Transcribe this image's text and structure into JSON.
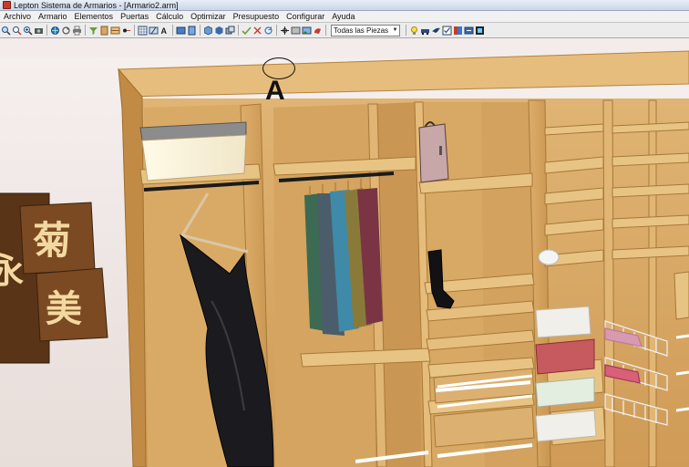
{
  "window": {
    "title": "Lepton Sistema de Armarios - [Armario2.arm]"
  },
  "menu": [
    "Archivo",
    "Armario",
    "Elementos",
    "Puertas",
    "Cálculo",
    "Optimizar",
    "Presupuesto",
    "Configurar",
    "Ayuda"
  ],
  "toolbar": {
    "piece_filter": {
      "selected": "Todas las Piezas"
    }
  },
  "annotation": {
    "letter": "A"
  },
  "scene": {
    "wall_art": {
      "top_glyph": "菊",
      "middle_glyph": "美",
      "left_glyph": "永"
    }
  },
  "colors": {
    "wood": "#d7a862",
    "wood_dark": "#b5833f",
    "wall": "#efe6e3",
    "accent_red": "#c83a2a"
  }
}
